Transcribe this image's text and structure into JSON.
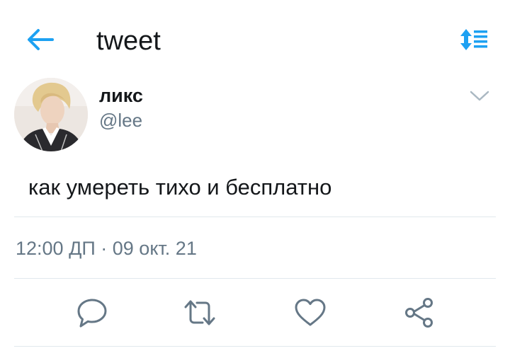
{
  "header": {
    "title": "tweet",
    "back_icon": "arrow-left-icon",
    "sort_icon": "sort-list-icon",
    "accent_color": "#1da1f2"
  },
  "tweet": {
    "author_name": "ликс",
    "author_handle": "@lee",
    "text": "как умереть тихо и бесплатно",
    "time": "12:00 ДП",
    "separator": " · ",
    "date": "09 окт. 21",
    "menu_icon": "chevron-down-icon"
  },
  "actions": {
    "reply_icon": "reply-bubble-icon",
    "retweet_icon": "retweet-icon",
    "like_icon": "heart-icon",
    "share_icon": "share-icon",
    "icon_color": "#657786"
  }
}
